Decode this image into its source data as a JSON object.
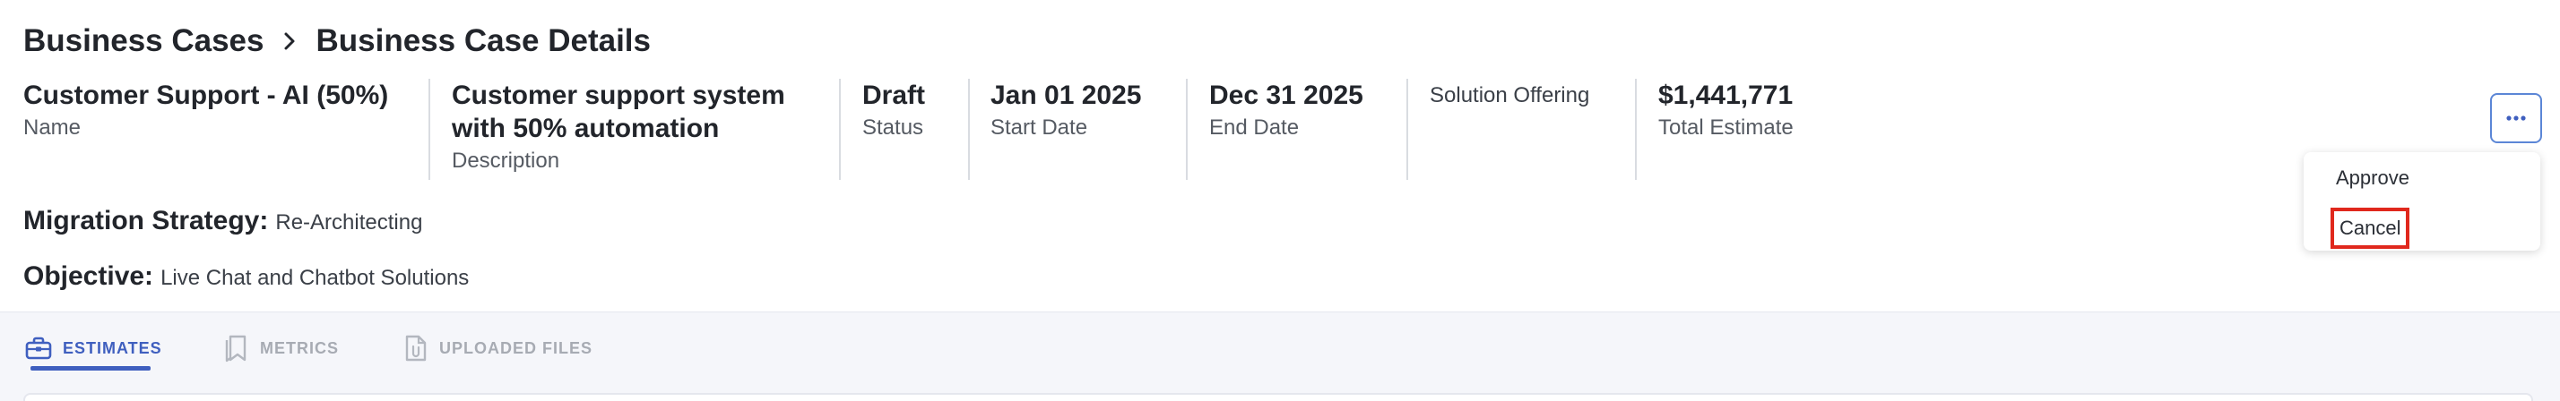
{
  "breadcrumb": {
    "parent": "Business Cases",
    "current": "Business Case Details"
  },
  "details": {
    "name": {
      "value": "Customer Support - AI (50%)",
      "label": "Name"
    },
    "description": {
      "value_line1": "Customer support system",
      "value_line2": "with 50% automation",
      "label": "Description"
    },
    "status": {
      "value": "Draft",
      "label": "Status"
    },
    "start_date": {
      "value": "Jan 01 2025",
      "label": "Start Date"
    },
    "end_date": {
      "value": "Dec 31 2025",
      "label": "End Date"
    },
    "solution_offering": {
      "value": "Solution Offering"
    },
    "total_estimate": {
      "value": "$1,441,771",
      "label": "Total Estimate"
    }
  },
  "migration_strategy": {
    "key": "Migration Strategy:",
    "value": "Re-Architecting"
  },
  "objective": {
    "key": "Objective:",
    "value": "Live Chat and Chatbot Solutions"
  },
  "actions_menu": {
    "items": [
      "Approve",
      "Cancel"
    ]
  },
  "tabs": [
    {
      "label": "ESTIMATES",
      "icon": "briefcase-icon",
      "active": true
    },
    {
      "label": "METRICS",
      "icon": "bookmarks-icon",
      "active": false
    },
    {
      "label": "UPLOADED FILES",
      "icon": "file-attachment-icon",
      "active": false
    }
  ],
  "colors": {
    "accent": "#3f5fbf",
    "highlight": "#e0281d",
    "tab_bar_bg": "#f5f6fa"
  }
}
